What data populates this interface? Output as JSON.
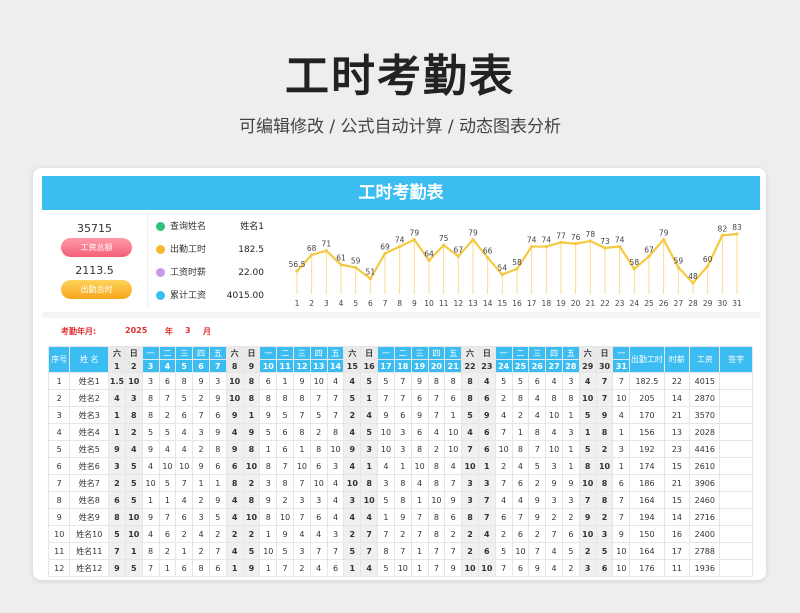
{
  "page": {
    "title": "工时考勤表",
    "subtitle": "可编辑修改 /  公式自动计算  /  动态图表分析"
  },
  "card": {
    "banner": "工时考勤表"
  },
  "summary": {
    "wage_total_value": "35715",
    "wage_total_label": "工资总额",
    "hours_total_value": "2113.5",
    "hours_total_label": "出勤总时"
  },
  "query": {
    "rows": [
      {
        "label": "查询姓名",
        "value": "姓名1",
        "color": "#2ec27e",
        "icon": "search-icon"
      },
      {
        "label": "出勤工时",
        "value": "182.5",
        "color": "#f5b82e",
        "icon": "clock-icon"
      },
      {
        "label": "工资时薪",
        "value": "22.00",
        "color": "#c99ae8",
        "icon": "coin-icon"
      },
      {
        "label": "累计工资",
        "value": "4015.00",
        "color": "#3bbdf2",
        "icon": "wallet-icon"
      }
    ]
  },
  "chart_data": {
    "type": "line",
    "x": [
      1,
      2,
      3,
      4,
      5,
      6,
      7,
      8,
      9,
      10,
      11,
      12,
      13,
      14,
      15,
      16,
      17,
      18,
      19,
      20,
      21,
      22,
      23,
      24,
      25,
      26,
      27,
      28,
      29,
      30,
      31
    ],
    "values": [
      56.5,
      68,
      71,
      61,
      59,
      51,
      69,
      74,
      79,
      64,
      75,
      67,
      79,
      66,
      54,
      58,
      74,
      74,
      77,
      76,
      78,
      73,
      74,
      58,
      67,
      79,
      59,
      48,
      60,
      82,
      83
    ],
    "line_color": "#f5c842"
  },
  "period": {
    "label": "考勤年月:",
    "year": "2025",
    "year_unit": "年",
    "month": "3",
    "month_unit": "月"
  },
  "table": {
    "col_seq": "序号",
    "col_name": "姓 名",
    "weekdays": [
      "六",
      "日",
      "一",
      "二",
      "三",
      "四",
      "五",
      "六",
      "日",
      "一",
      "二",
      "三",
      "四",
      "五",
      "六",
      "日",
      "一",
      "二",
      "三",
      "四",
      "五",
      "六",
      "日",
      "一",
      "二",
      "三",
      "四",
      "五",
      "六",
      "日",
      "一"
    ],
    "days": [
      "1",
      "2",
      "3",
      "4",
      "5",
      "6",
      "7",
      "8",
      "9",
      "10",
      "11",
      "12",
      "13",
      "14",
      "15",
      "16",
      "17",
      "18",
      "19",
      "20",
      "21",
      "22",
      "23",
      "24",
      "25",
      "26",
      "27",
      "28",
      "29",
      "30",
      "31"
    ],
    "col_hours": "出勤工时",
    "col_rate": "时薪",
    "col_wage": "工资",
    "col_sign": "签字",
    "rows": [
      {
        "seq": "1",
        "name": "姓名1",
        "d": [
          "1.5",
          "10",
          "3",
          "6",
          "8",
          "9",
          "3",
          "10",
          "8",
          "6",
          "1",
          "9",
          "10",
          "4",
          "4",
          "5",
          "5",
          "7",
          "9",
          "8",
          "8",
          "8",
          "4",
          "5",
          "5",
          "6",
          "4",
          "3",
          "4",
          "7",
          "7"
        ],
        "hours": "182.5",
        "rate": "22",
        "wage": "4015"
      },
      {
        "seq": "2",
        "name": "姓名2",
        "d": [
          "4",
          "3",
          "8",
          "7",
          "5",
          "2",
          "9",
          "10",
          "8",
          "8",
          "8",
          "8",
          "7",
          "7",
          "5",
          "1",
          "7",
          "7",
          "6",
          "7",
          "6",
          "8",
          "6",
          "2",
          "8",
          "4",
          "8",
          "8",
          "10",
          "7",
          "10"
        ],
        "hours": "205",
        "rate": "14",
        "wage": "2870"
      },
      {
        "seq": "3",
        "name": "姓名3",
        "d": [
          "1",
          "8",
          "8",
          "2",
          "6",
          "7",
          "6",
          "9",
          "1",
          "9",
          "5",
          "7",
          "5",
          "7",
          "2",
          "4",
          "9",
          "6",
          "9",
          "7",
          "1",
          "5",
          "9",
          "4",
          "2",
          "4",
          "10",
          "1",
          "5",
          "9",
          "4"
        ],
        "hours": "170",
        "rate": "21",
        "wage": "3570"
      },
      {
        "seq": "4",
        "name": "姓名4",
        "d": [
          "1",
          "2",
          "5",
          "5",
          "4",
          "3",
          "9",
          "4",
          "9",
          "5",
          "6",
          "8",
          "2",
          "8",
          "4",
          "5",
          "10",
          "3",
          "6",
          "4",
          "10",
          "4",
          "6",
          "7",
          "1",
          "8",
          "4",
          "3",
          "1",
          "8",
          "1"
        ],
        "hours": "156",
        "rate": "13",
        "wage": "2028"
      },
      {
        "seq": "5",
        "name": "姓名5",
        "d": [
          "9",
          "4",
          "9",
          "4",
          "4",
          "2",
          "8",
          "9",
          "8",
          "1",
          "6",
          "1",
          "8",
          "10",
          "9",
          "3",
          "10",
          "3",
          "8",
          "2",
          "10",
          "7",
          "6",
          "10",
          "8",
          "7",
          "10",
          "1",
          "5",
          "2",
          "3"
        ],
        "hours": "192",
        "rate": "23",
        "wage": "4416"
      },
      {
        "seq": "6",
        "name": "姓名6",
        "d": [
          "3",
          "5",
          "4",
          "10",
          "10",
          "9",
          "6",
          "6",
          "10",
          "8",
          "7",
          "10",
          "6",
          "3",
          "4",
          "1",
          "4",
          "1",
          "10",
          "8",
          "4",
          "10",
          "1",
          "2",
          "4",
          "5",
          "3",
          "1",
          "8",
          "10",
          "1"
        ],
        "hours": "174",
        "rate": "15",
        "wage": "2610"
      },
      {
        "seq": "7",
        "name": "姓名7",
        "d": [
          "2",
          "5",
          "10",
          "5",
          "7",
          "1",
          "1",
          "8",
          "2",
          "3",
          "8",
          "7",
          "10",
          "4",
          "10",
          "8",
          "3",
          "8",
          "4",
          "8",
          "7",
          "3",
          "3",
          "7",
          "6",
          "2",
          "9",
          "9",
          "10",
          "8",
          "6"
        ],
        "hours": "186",
        "rate": "21",
        "wage": "3906"
      },
      {
        "seq": "8",
        "name": "姓名8",
        "d": [
          "6",
          "5",
          "1",
          "1",
          "4",
          "2",
          "9",
          "4",
          "8",
          "9",
          "2",
          "3",
          "3",
          "4",
          "3",
          "10",
          "5",
          "8",
          "1",
          "10",
          "9",
          "3",
          "7",
          "4",
          "4",
          "9",
          "3",
          "3",
          "7",
          "8",
          "7"
        ],
        "hours": "164",
        "rate": "15",
        "wage": "2460"
      },
      {
        "seq": "9",
        "name": "姓名9",
        "d": [
          "8",
          "10",
          "9",
          "7",
          "6",
          "3",
          "5",
          "4",
          "10",
          "8",
          "10",
          "7",
          "6",
          "4",
          "4",
          "4",
          "1",
          "9",
          "7",
          "8",
          "6",
          "8",
          "7",
          "6",
          "7",
          "9",
          "2",
          "2",
          "9",
          "2",
          "7"
        ],
        "hours": "194",
        "rate": "14",
        "wage": "2716"
      },
      {
        "seq": "10",
        "name": "姓名10",
        "d": [
          "5",
          "10",
          "4",
          "6",
          "2",
          "4",
          "2",
          "2",
          "2",
          "1",
          "9",
          "4",
          "4",
          "3",
          "2",
          "7",
          "7",
          "2",
          "7",
          "8",
          "2",
          "2",
          "4",
          "2",
          "6",
          "2",
          "7",
          "6",
          "10",
          "3",
          "9"
        ],
        "hours": "150",
        "rate": "16",
        "wage": "2400"
      },
      {
        "seq": "11",
        "name": "姓名11",
        "d": [
          "7",
          "1",
          "8",
          "2",
          "1",
          "2",
          "7",
          "4",
          "5",
          "10",
          "5",
          "3",
          "7",
          "7",
          "5",
          "7",
          "8",
          "7",
          "1",
          "7",
          "7",
          "2",
          "6",
          "5",
          "10",
          "7",
          "4",
          "5",
          "2",
          "5",
          "10"
        ],
        "hours": "164",
        "rate": "17",
        "wage": "2788"
      },
      {
        "seq": "12",
        "name": "姓名12",
        "d": [
          "9",
          "5",
          "7",
          "1",
          "6",
          "8",
          "6",
          "1",
          "9",
          "1",
          "7",
          "2",
          "4",
          "6",
          "1",
          "4",
          "5",
          "10",
          "1",
          "7",
          "9",
          "10",
          "10",
          "7",
          "6",
          "9",
          "4",
          "2",
          "3",
          "6",
          "10"
        ],
        "hours": "176",
        "rate": "11",
        "wage": "1936"
      }
    ]
  }
}
